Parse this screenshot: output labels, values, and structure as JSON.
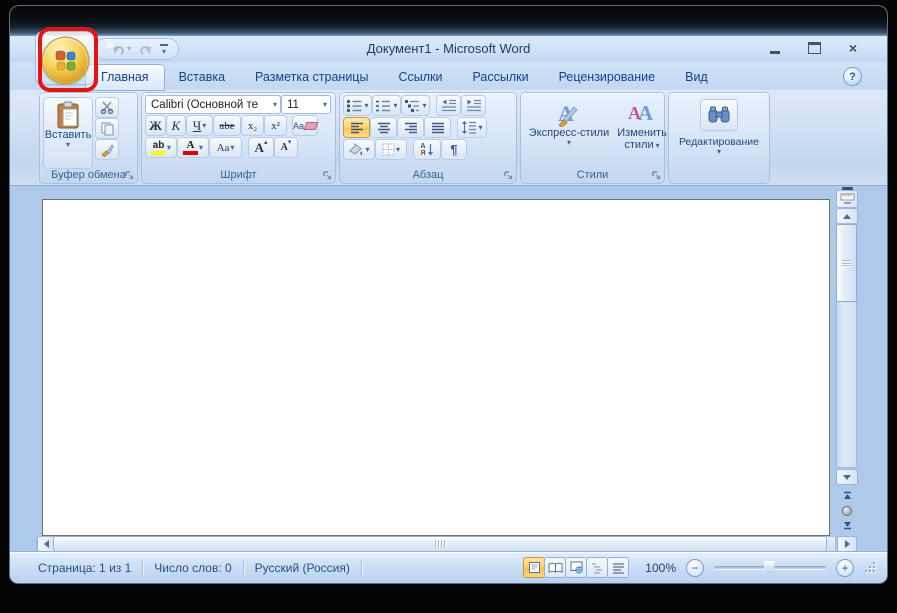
{
  "window": {
    "title": "Документ1 - Microsoft Word"
  },
  "tabs": [
    {
      "label": "Главная",
      "active": true
    },
    {
      "label": "Вставка",
      "active": false
    },
    {
      "label": "Разметка страницы",
      "active": false
    },
    {
      "label": "Ссылки",
      "active": false
    },
    {
      "label": "Рассылки",
      "active": false
    },
    {
      "label": "Рецензирование",
      "active": false
    },
    {
      "label": "Вид",
      "active": false
    }
  ],
  "ribbon": {
    "clipboard": {
      "label": "Буфер обмена",
      "paste": "Вставить"
    },
    "font": {
      "label": "Шрифт",
      "family": "Calibri (Основной те",
      "size": "11",
      "bold": "Ж",
      "italic": "К",
      "underline": "Ч",
      "strikethrough": "abe",
      "subscript": "x₂",
      "superscript": "x²",
      "clear_format": "Aa",
      "highlight": "ab",
      "font_color": "А",
      "change_case": "Aa",
      "grow_font": "А",
      "shrink_font": "А"
    },
    "paragraph": {
      "label": "Абзац",
      "sort_a": "А",
      "sort_z": "Я"
    },
    "styles": {
      "label": "Стили",
      "quick_styles": "Экспресс-стили",
      "change_styles_1": "Изменить",
      "change_styles_2": "стили"
    },
    "editing": {
      "label": "Редактирование"
    }
  },
  "statusbar": {
    "page": "Страница: 1 из 1",
    "words": "Число слов: 0",
    "language": "Русский (Россия)",
    "zoom_level": "100%"
  },
  "icons": {
    "dropdown_arrow": "▾",
    "help": "?",
    "close": "×",
    "minus": "−",
    "plus": "+",
    "pilcrow": "¶",
    "grow_mark": "▴",
    "shrink_mark": "▾"
  },
  "colors": {
    "annotation_red": "#e21414",
    "ribbon_text_blue": "#15428b",
    "highlight_yellow": "#ffff00",
    "font_color_red": "#e00000",
    "active_button_orange": "#fcc34e"
  }
}
